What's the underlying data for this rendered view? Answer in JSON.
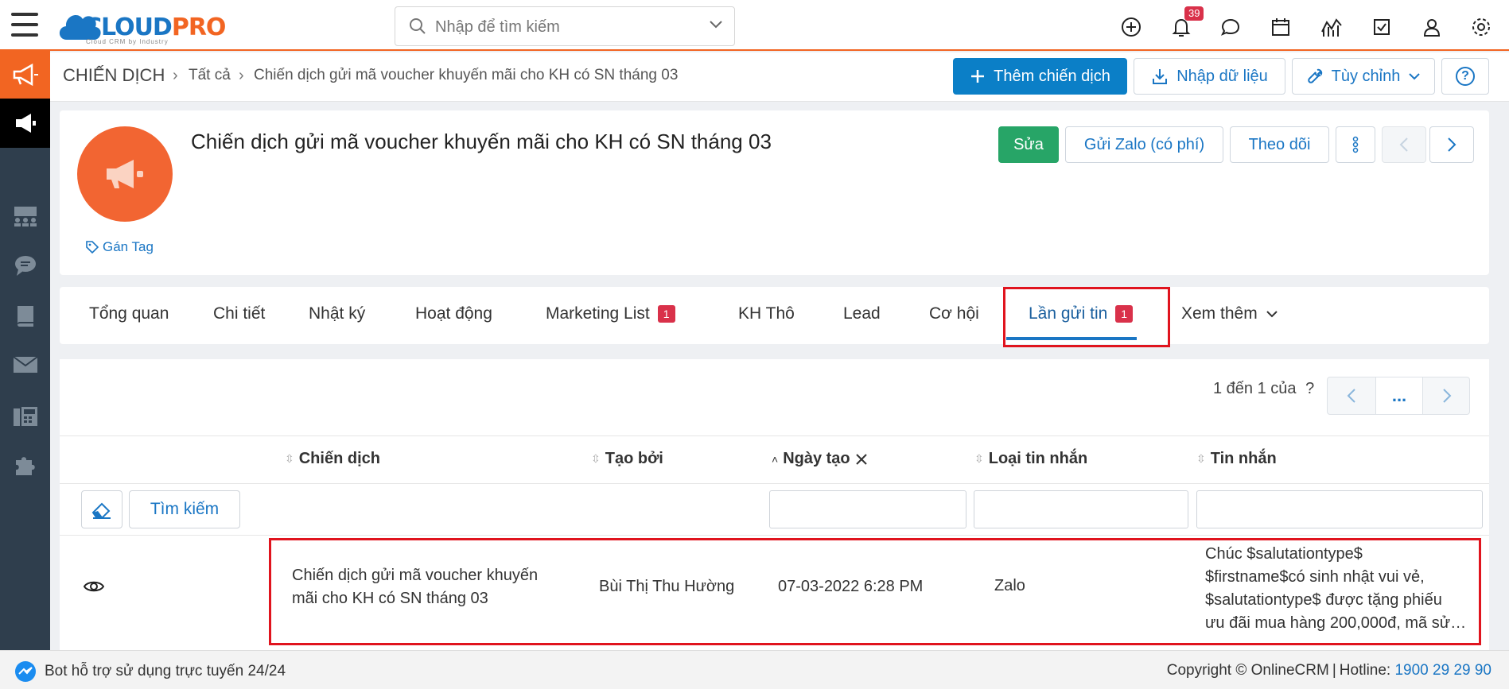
{
  "topbar": {
    "logo_main": "CLOUD",
    "logo_accent": "PRO",
    "logo_tagline": "Cloud CRM by Industry",
    "search_placeholder": "Nhập để tìm kiếm",
    "notification_count": "39",
    "icons": [
      "plus-circle-icon",
      "bell-icon",
      "chat-icon",
      "calendar-icon",
      "chart-icon",
      "checkbox-icon",
      "user-icon",
      "gear-icon"
    ]
  },
  "sidebar": {
    "items": [
      "megaphone-icon",
      "campaign-icon",
      "users-icon",
      "comment-icon",
      "book-icon",
      "mail-icon",
      "fax-icon",
      "puzzle-icon"
    ]
  },
  "breadcrumb": {
    "root": "CHIẾN DỊCH",
    "level1": "Tất cả",
    "current": "Chiến dịch gửi mã voucher khuyến mãi cho KH có SN tháng 03"
  },
  "actions": {
    "add": "Thêm chiến dịch",
    "import": "Nhập dữ liệu",
    "customize": "Tùy chỉnh",
    "help": "?"
  },
  "record": {
    "title": "Chiến dịch gửi mã voucher khuyến mãi cho KH có SN tháng 03",
    "tag_label": "Gán Tag",
    "edit": "Sửa",
    "send_zalo": "Gửi Zalo (có phí)",
    "follow": "Theo dõi"
  },
  "tabs": [
    {
      "label": "Tổng quan"
    },
    {
      "label": "Chi tiết"
    },
    {
      "label": "Nhật ký"
    },
    {
      "label": "Hoạt động"
    },
    {
      "label": "Marketing List",
      "count": "1"
    },
    {
      "label": "KH Thô"
    },
    {
      "label": "Lead"
    },
    {
      "label": "Cơ hội"
    },
    {
      "label": "Lần gửi tin",
      "count": "1"
    },
    {
      "label": "Xem thêm"
    }
  ],
  "list": {
    "pager_text": "1 đến 1 của",
    "pager_q": "?",
    "pager_more": "...",
    "search_button": "Tìm kiếm",
    "columns": [
      "Chiến dịch",
      "Tạo bởi",
      "Ngày tạo",
      "Loại tin nhắn",
      "Tin nhắn"
    ],
    "rows": [
      {
        "campaign_line1": "Chiến dịch gửi mã voucher khuyến",
        "campaign_line2": "mãi cho KH có SN tháng 03",
        "created_by": "Bùi Thị Thu Hường",
        "created_at": "07-03-2022 6:28 PM",
        "message_type": "Zalo",
        "message_line1": "Chúc $salutationtype$",
        "message_line2": "$firstname$có sinh nhật vui vẻ,",
        "message_line3": "$salutationtype$ được tặng phiếu",
        "message_line4": "ưu đãi mua hàng 200,000đ, mã sử…"
      }
    ]
  },
  "footer": {
    "bot_text": "Bot hỗ trợ sử dụng trực tuyến 24/24",
    "copyright": "Copyright © OnlineCRM",
    "hotline_label": "Hotline:",
    "hotline": "1900 29 29 90"
  },
  "colors": {
    "brand_blue": "#0b7fc7",
    "brand_orange": "#f26522",
    "success_green": "#27a567",
    "badge_red": "#d9314a",
    "highlight_red": "#e0141e"
  }
}
